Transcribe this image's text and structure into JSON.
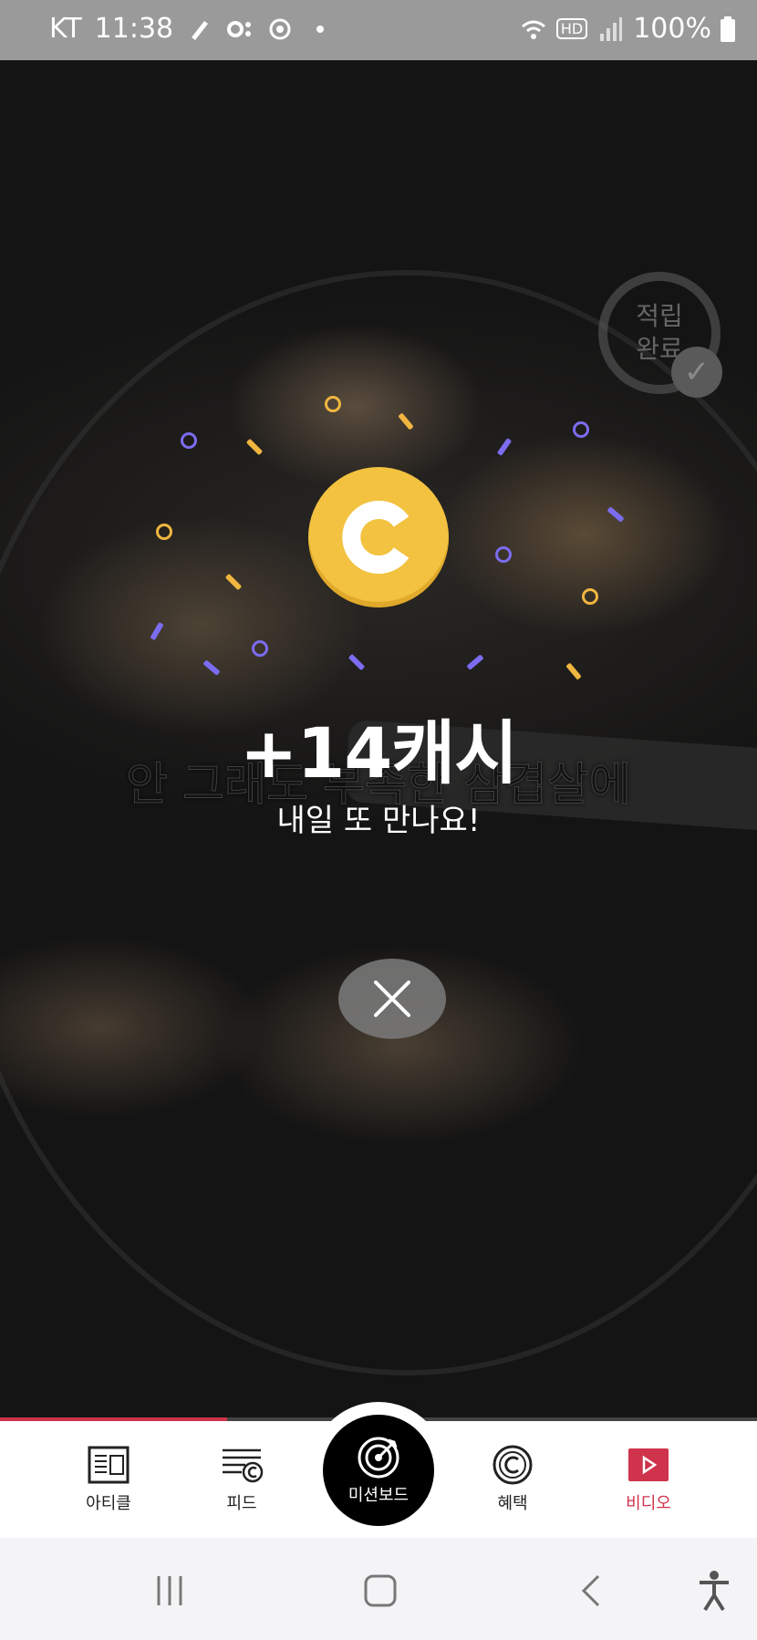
{
  "status_bar": {
    "carrier": "KT",
    "time": "11:38",
    "battery": "100%",
    "network_badge": "HD"
  },
  "video": {
    "subtitle": "안 그래도 부족한 삼겹살에",
    "progress": 0.3
  },
  "complete_badge": {
    "line1": "적립",
    "line2": "완료"
  },
  "reward": {
    "amount_text": "+14캐시",
    "message": "내일 또 만나요!"
  },
  "bottom_nav": {
    "items": [
      {
        "label": "아티클",
        "icon": "article-icon"
      },
      {
        "label": "피드",
        "icon": "feed-icon"
      },
      {
        "label": "미션보드",
        "icon": "target-icon"
      },
      {
        "label": "혜택",
        "icon": "cash-coin-icon"
      },
      {
        "label": "비디오",
        "icon": "video-play-icon"
      }
    ],
    "active_index": 4
  },
  "colors": {
    "accent": "#d0334c",
    "coin": "#f2c240",
    "confetti_purple": "#7c6cf0",
    "confetti_gold": "#f0b640"
  }
}
